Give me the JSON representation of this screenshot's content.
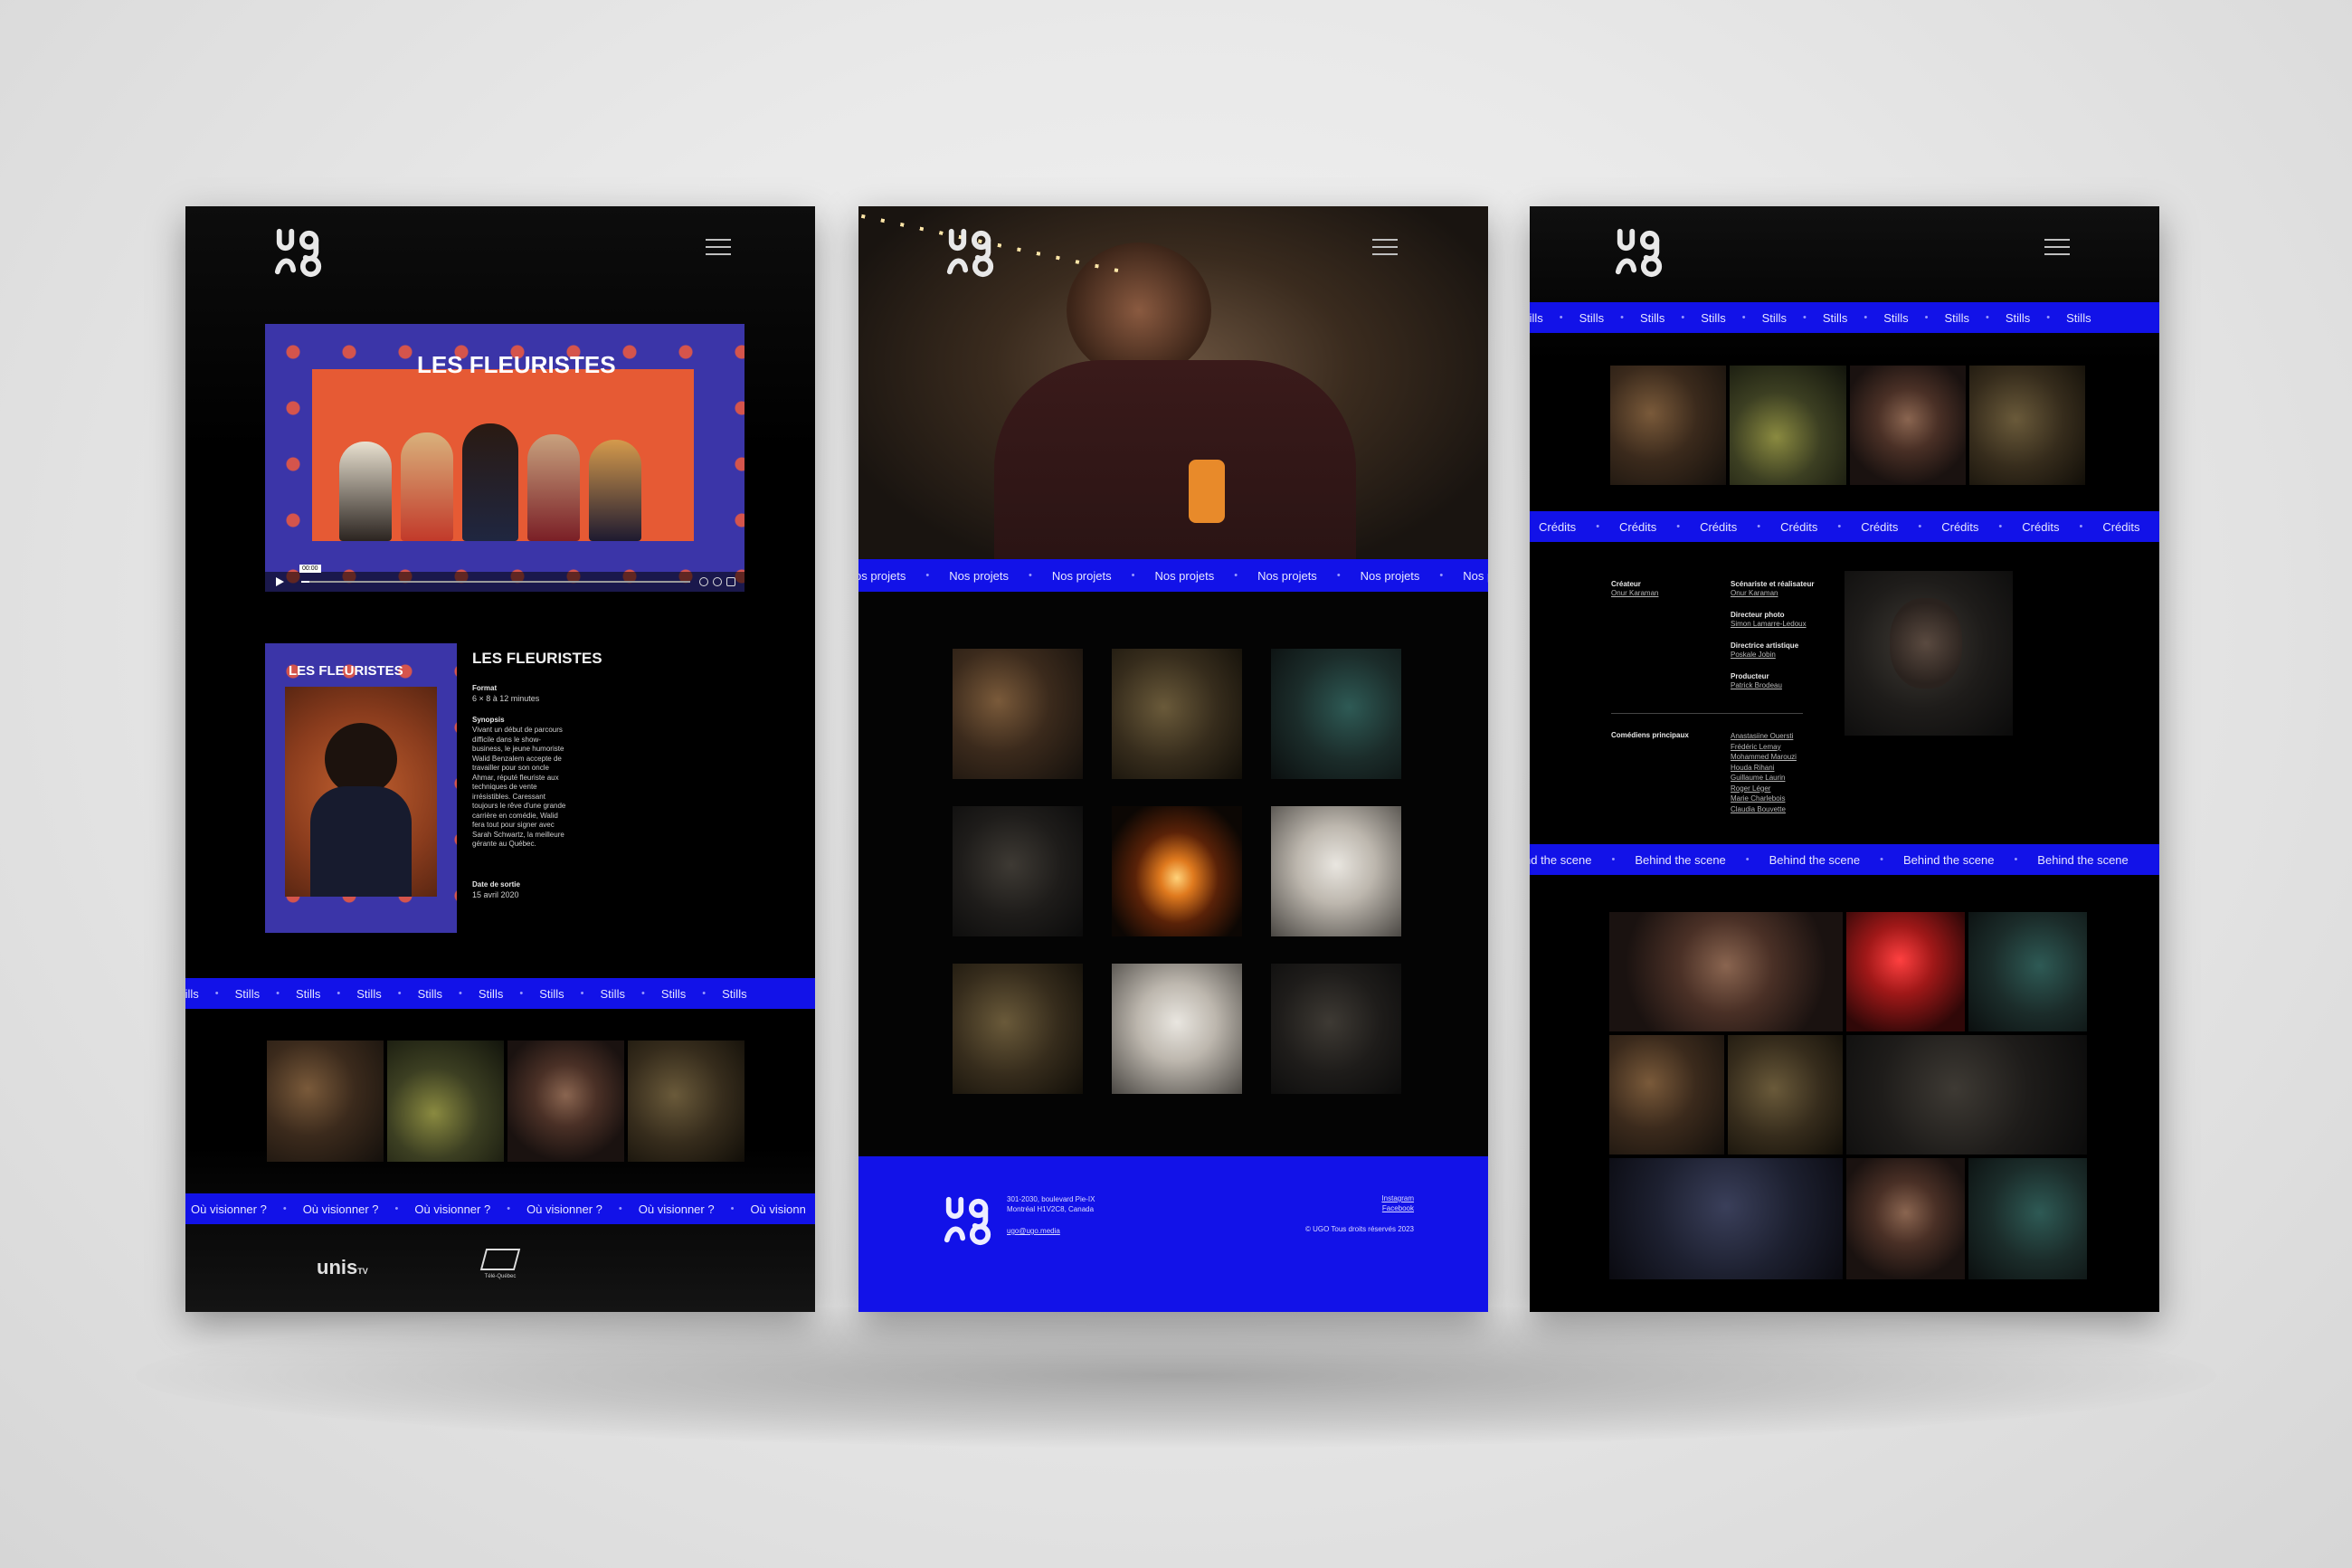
{
  "panel1": {
    "video": {
      "title": "LES FLEURISTES",
      "time": "00:00"
    },
    "project": {
      "title": "LES FLEURISTES",
      "poster_title": "LES FLEURISTES",
      "format_label": "Format",
      "format_value": "6 × 8 à 12 minutes",
      "synopsis_label": "Synopsis",
      "synopsis_lines": [
        "Vivant un début de parcours",
        "difficile dans le show-",
        "business, le jeune humoriste",
        "Walid Benzalem accepte de",
        "travailler pour son oncle",
        "Ahmar, réputé fleuriste aux",
        "techniques de vente",
        "irrésistibles. Caressant",
        "toujours le rêve d'une grande",
        "carrière en comédie, Walid",
        "fera tout pour signer avec",
        "Sarah Schwartz, la meilleure",
        "gérante au Québec."
      ],
      "release_label": "Date de sortie",
      "release_value": "15 avril 2020"
    },
    "ticker_stills": {
      "word": "Stills",
      "items": [
        "tills",
        "Stills",
        "Stills",
        "Stills",
        "Stills",
        "Stills",
        "Stills",
        "Stills",
        "Stills",
        "Stills"
      ]
    },
    "ticker_watch": {
      "word": "Où visionner ?",
      "items": [
        "Où visionner ?",
        "Où visionner ?",
        "Où visionner ?",
        "Où visionner ?",
        "Où visionner ?",
        "Où visionn"
      ]
    },
    "partners": {
      "unis": "unis",
      "unis_sub": "TV",
      "telequebec": "Télé-Québec"
    }
  },
  "panel2": {
    "ticker_projects": {
      "items": [
        "os projets",
        "Nos projets",
        "Nos projets",
        "Nos projets",
        "Nos projets",
        "Nos projets",
        "Nos pro"
      ]
    },
    "footer": {
      "address_line1": "301-2030, boulevard Pie-IX",
      "address_line2": "Montréal H1V2C8, Canada",
      "email": "ugo@ugo.media",
      "instagram": "Instagram",
      "facebook": "Facebook",
      "copyright": "© UGO Tous droits réservés 2023"
    },
    "grid_tones": [
      "warm",
      "olive",
      "teal",
      "dark",
      "fire",
      "pale",
      "olive",
      "pale",
      "dark"
    ]
  },
  "panel3": {
    "ticker_stills": {
      "items": [
        "tills",
        "Stills",
        "Stills",
        "Stills",
        "Stills",
        "Stills",
        "Stills",
        "Stills",
        "Stills",
        "Stills"
      ]
    },
    "ticker_credits": {
      "items": [
        "Crédits",
        "Crédits",
        "Crédits",
        "Crédits",
        "Crédits",
        "Crédits",
        "Crédits",
        "Crédits"
      ]
    },
    "ticker_behind": {
      "items": [
        "nd the scene",
        "Behind the scene",
        "Behind the scene",
        "Behind the scene",
        "Behind the scene"
      ]
    },
    "credits": {
      "creator_label": "Créateur",
      "creator": "Onur Karaman",
      "writer_director_label": "Scénariste et réalisateur",
      "writer_director": "Onur Karaman",
      "dop_label": "Directeur photo",
      "dop": "Simon Lamarre-Ledoux",
      "art_label": "Directrice artistique",
      "art": "Poskale Jobin",
      "producer_label": "Producteur",
      "producer": "Patrick Brodeau",
      "cast_label": "Comédiens principaux",
      "cast": [
        "Anastasiine Ouersti",
        "Frédéric Lemay",
        "Mohammed Marouzi",
        "Houda Rihani",
        "Guillaume Laurin",
        "Roger Léger",
        "Marie Charlebois",
        "Claudia Bouvette"
      ]
    }
  },
  "colors": {
    "accent_blue": "#1212e8",
    "background": "#000000"
  }
}
